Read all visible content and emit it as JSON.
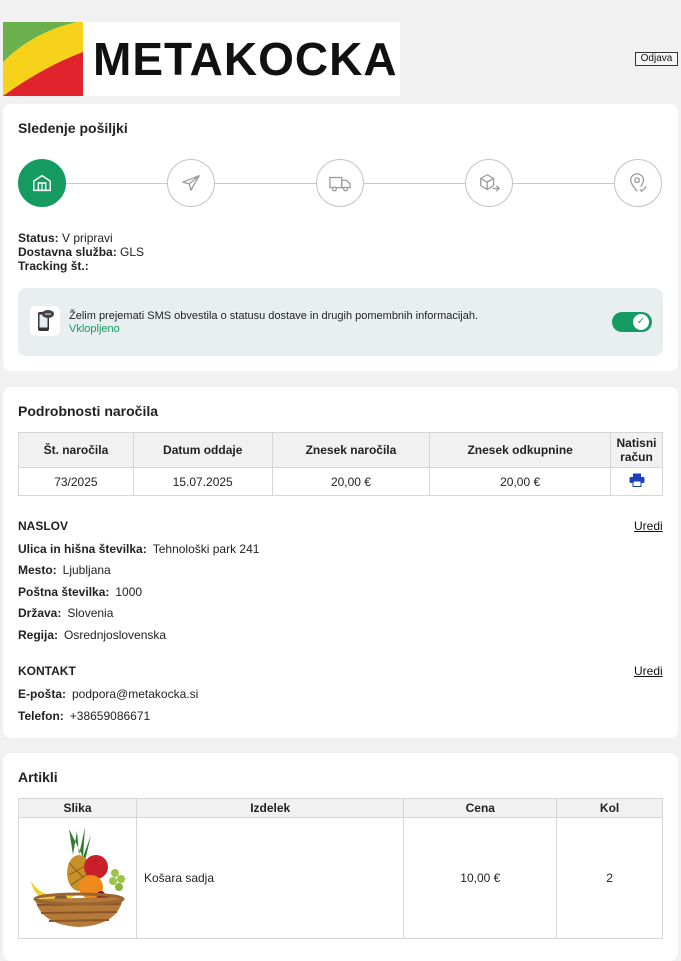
{
  "header": {
    "logo_text": "METAKOCKA",
    "logout_label": "Odjava"
  },
  "tracking": {
    "title": "Sledenje pošiljki",
    "steps": [
      {
        "icon": "warehouse-icon",
        "active": true
      },
      {
        "icon": "airplane-icon",
        "active": false
      },
      {
        "icon": "delivery-truck-icon",
        "active": false
      },
      {
        "icon": "package-transfer-icon",
        "active": false
      },
      {
        "icon": "location-pin-check-icon",
        "active": false
      }
    ],
    "status_label": "Status:",
    "status_value": "V pripravi",
    "carrier_label": "Dostavna služba:",
    "carrier_value": "GLS",
    "tracking_label": "Tracking št.:",
    "tracking_value": "",
    "sms_text": "Želim prejemati SMS obvestila o statusu dostave in drugih pomembnih informacijah.",
    "sms_status": "Vklopljeno",
    "sms_enabled": true
  },
  "order": {
    "title": "Podrobnosti naročila",
    "columns": [
      "Št. naročila",
      "Datum oddaje",
      "Znesek naročila",
      "Znesek odkupnine",
      "Natisni račun"
    ],
    "row": {
      "order_no": "73/2025",
      "date": "15.07.2025",
      "amount": "20,00 €",
      "cod_amount": "20,00 €"
    },
    "address": {
      "heading": "NASLOV",
      "edit_label": "Uredi",
      "street_label": "Ulica in hišna številka:",
      "street": "Tehnološki park 241",
      "city_label": "Mesto:",
      "city": "Ljubljana",
      "postal_label": "Poštna številka:",
      "postal": "1000",
      "country_label": "Država:",
      "country": "Slovenia",
      "region_label": "Regija:",
      "region": "Osrednjoslovenska"
    },
    "contact": {
      "heading": "KONTAKT",
      "edit_label": "Uredi",
      "email_label": "E-pošta:",
      "email": "podpora@metakocka.si",
      "phone_label": "Telefon:",
      "phone": "+38659086671"
    }
  },
  "items": {
    "title": "Artikli",
    "columns": [
      "Slika",
      "Izdelek",
      "Cena",
      "Kol"
    ],
    "rows": [
      {
        "image": "fruit-basket",
        "name": "Košara sadja",
        "price": "10,00 €",
        "qty": "2"
      }
    ]
  },
  "colors": {
    "accent": "#159b61",
    "logo_red": "#e0232d",
    "logo_yellow": "#f6d21a",
    "logo_green": "#6ab04c",
    "print_icon": "#1b3fbf"
  }
}
